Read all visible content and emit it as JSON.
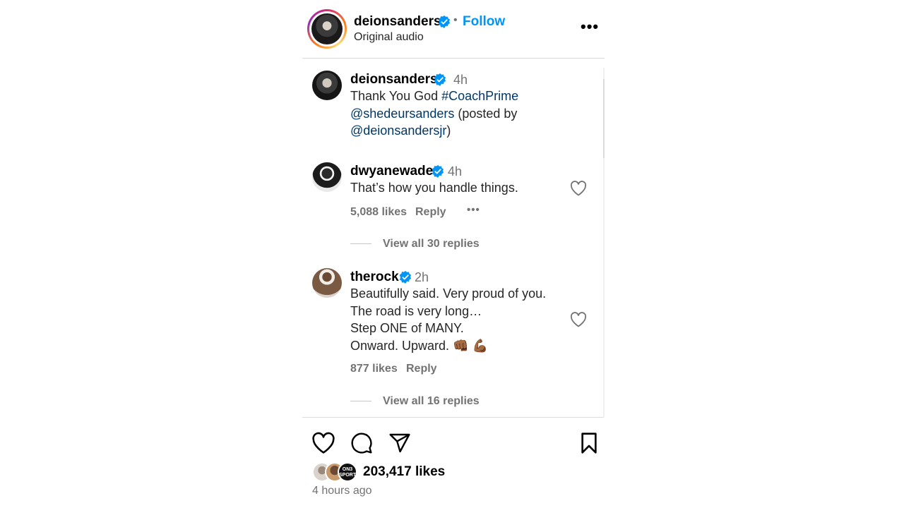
{
  "header": {
    "username": "deionsanders",
    "separator": "•",
    "follow_label": "Follow",
    "subtitle": "Original audio",
    "more_label": "•••"
  },
  "caption": {
    "username": "deionsanders",
    "time": "4h",
    "text_plain": "Thank You God ",
    "hashtag": "#CoachPrime",
    "mention1": "@shedeursanders",
    "mid_text": " (posted by",
    "mention2": "@deionsandersjr",
    "end_text": ")"
  },
  "comments": [
    {
      "username": "dwyanewade",
      "time": "4h",
      "lines": [
        "That’s how you handle things."
      ],
      "likes": "5,088 likes",
      "reply_label": "Reply",
      "more_label": "•••",
      "view_replies": "View all 30 replies"
    },
    {
      "username": "therock",
      "time": "2h",
      "lines": [
        "Beautifully said. Very proud of you.",
        "The road is very long…",
        "Step ONE of MANY.",
        "Onward. Upward. 👊🏾 💪🏾"
      ],
      "likes": "877 likes",
      "reply_label": "Reply",
      "view_replies": "View all 16 replies"
    }
  ],
  "footer": {
    "likes": "203,417 likes",
    "time_ago": "4 hours ago",
    "liker_badge_text": "ON3 SPORTS"
  },
  "colors": {
    "link": "#00376b",
    "follow": "#0095f6",
    "verified": "#0095f6",
    "muted": "#737373"
  },
  "icons": {
    "verified": "verified-badge-icon",
    "heart": "heart-icon",
    "comment": "comment-icon",
    "share": "share-icon",
    "save": "bookmark-icon",
    "more": "more-dots-icon"
  }
}
